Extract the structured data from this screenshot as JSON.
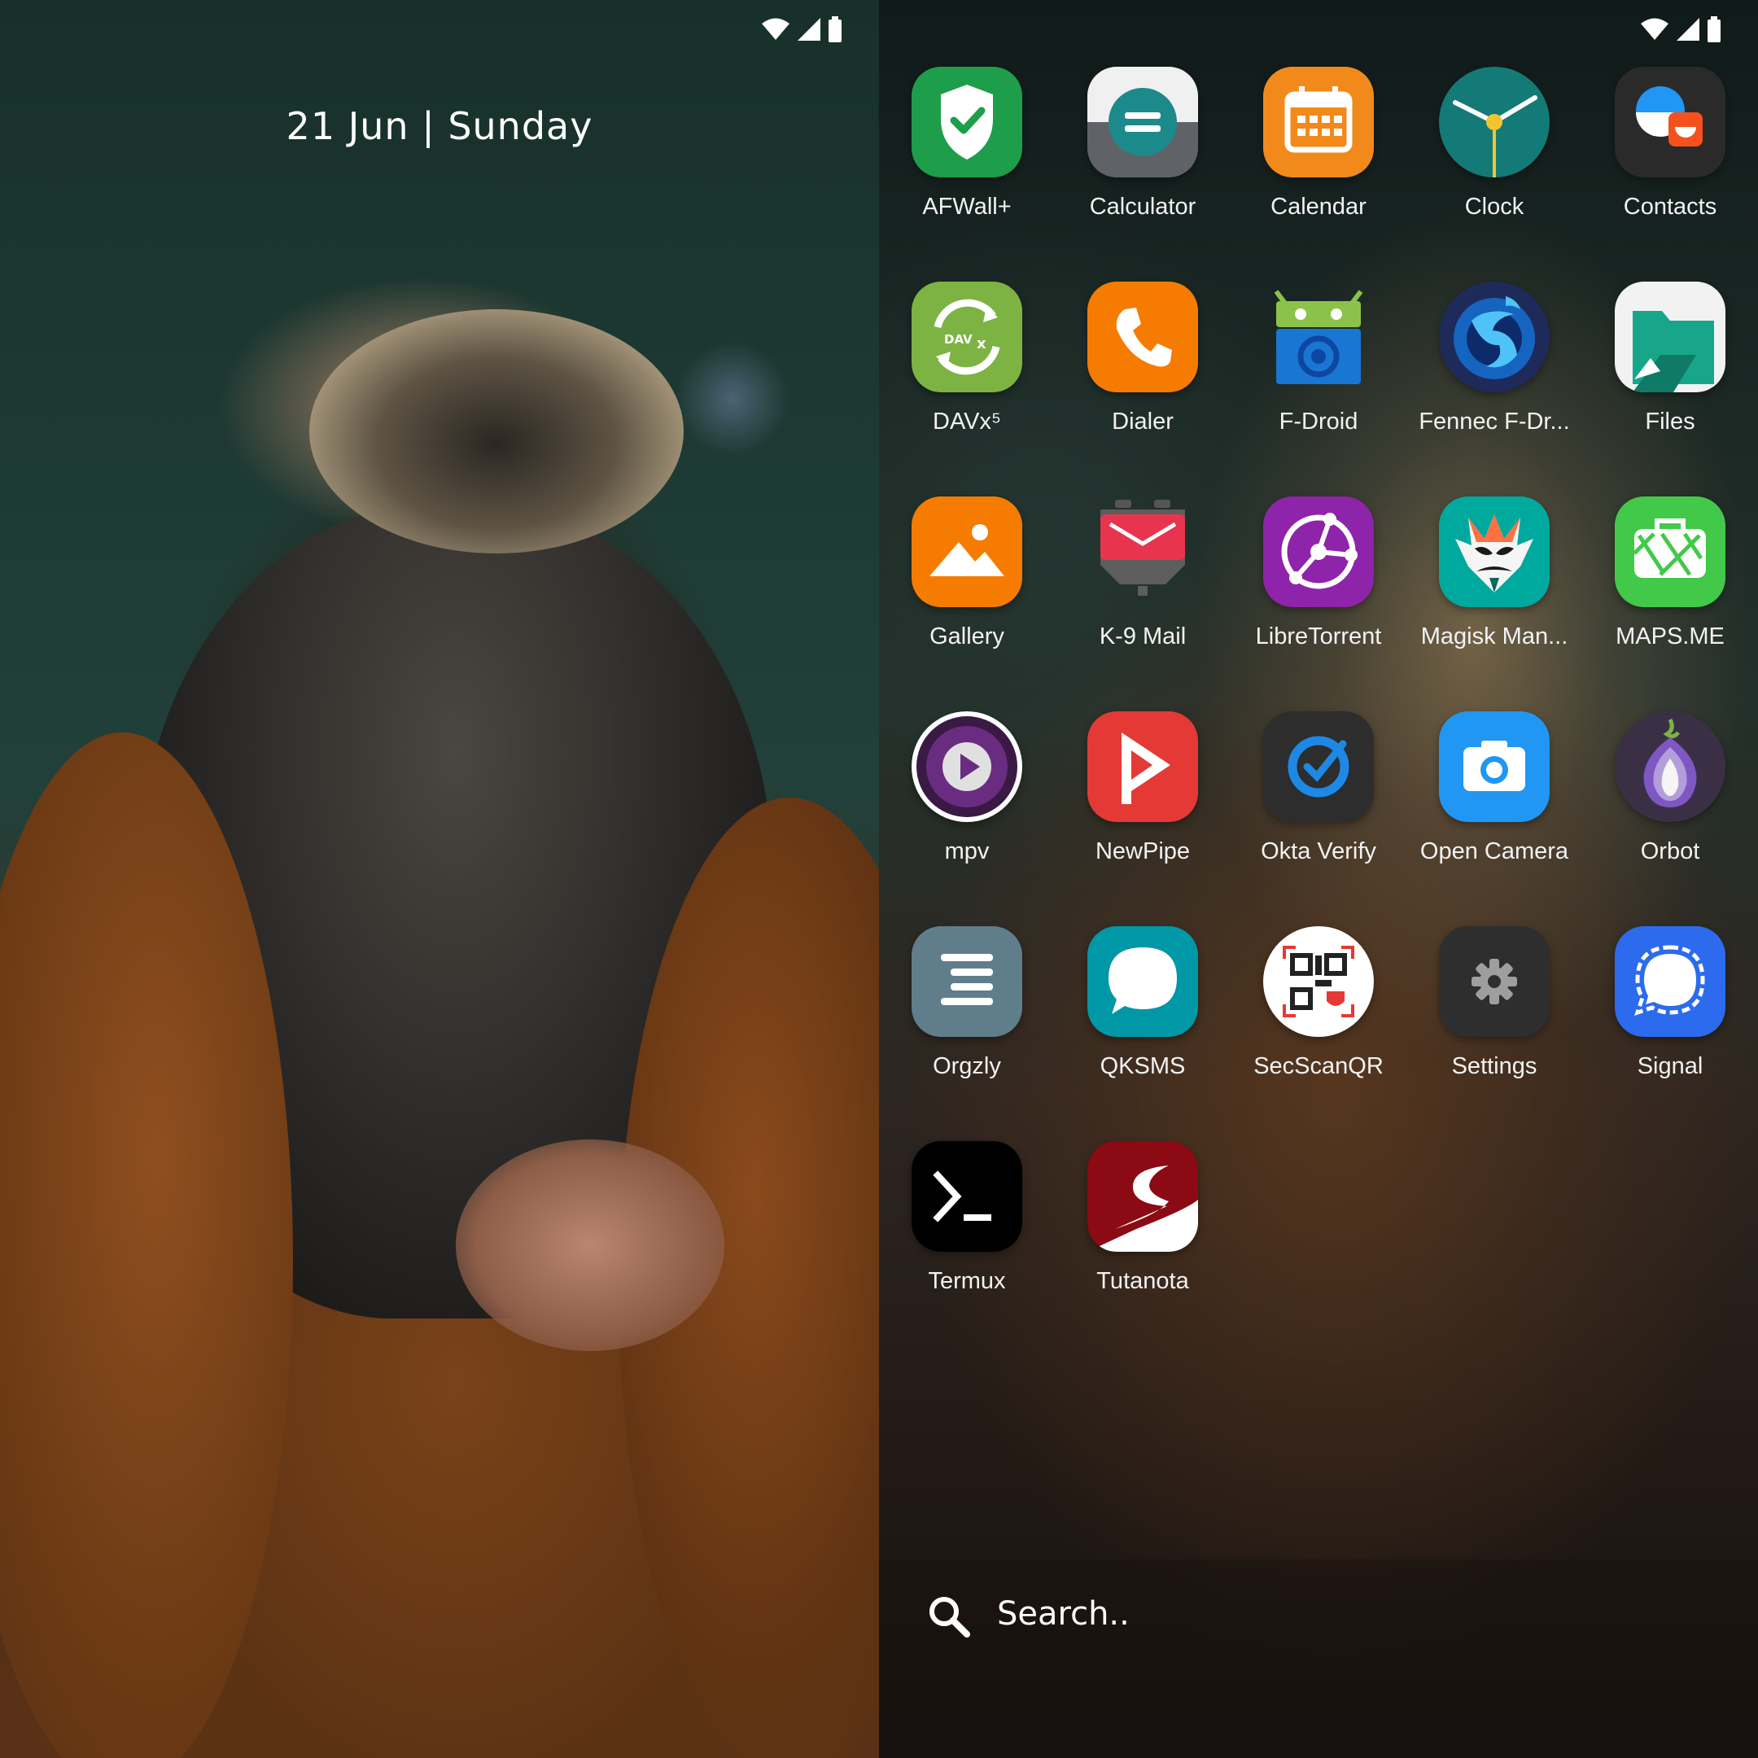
{
  "lock_screen": {
    "date": "21 Jun | Sunday"
  },
  "status_bar": {
    "icons": [
      "wifi-icon",
      "signal-icon",
      "battery-icon"
    ]
  },
  "apps": [
    {
      "label": "AFWall+",
      "icon": "afwall-shield-icon",
      "color": "#1e9d4b"
    },
    {
      "label": "Calculator",
      "icon": "calculator-icon",
      "color": "#e8e8e8"
    },
    {
      "label": "Calendar",
      "icon": "calendar-icon",
      "color": "#f28a1b"
    },
    {
      "label": "Clock",
      "icon": "clock-icon",
      "color": "#137a77"
    },
    {
      "label": "Contacts",
      "icon": "contacts-icon",
      "color": "#2a2a2a"
    },
    {
      "label": "DAVx⁵",
      "icon": "davx5-sync-icon",
      "color": "#7cb342"
    },
    {
      "label": "Dialer",
      "icon": "phone-icon",
      "color": "#f57c00"
    },
    {
      "label": "F-Droid",
      "icon": "fdroid-icon",
      "color": "#1976d2"
    },
    {
      "label": "Fennec F-Dr...",
      "icon": "fennec-fox-icon",
      "color": "#1e2a5a"
    },
    {
      "label": "Files",
      "icon": "folder-icon",
      "color": "#18a68b"
    },
    {
      "label": "Gallery",
      "icon": "gallery-icon",
      "color": "#f57c00"
    },
    {
      "label": "K-9 Mail",
      "icon": "k9-mail-icon",
      "color": "#e8344e"
    },
    {
      "label": "LibreTorrent",
      "icon": "libretorrent-icon",
      "color": "#8e24aa"
    },
    {
      "label": "Magisk Man...",
      "icon": "magisk-mask-icon",
      "color": "#00a99d"
    },
    {
      "label": "MAPS.ME",
      "icon": "maps-me-icon",
      "color": "#43c94a"
    },
    {
      "label": "mpv",
      "icon": "mpv-play-icon",
      "color": "#4a1b5a"
    },
    {
      "label": "NewPipe",
      "icon": "newpipe-play-icon",
      "color": "#e53935"
    },
    {
      "label": "Okta Verify",
      "icon": "okta-verify-icon",
      "color": "#2d2d2d"
    },
    {
      "label": "Open Camera",
      "icon": "camera-icon",
      "color": "#2196f3"
    },
    {
      "label": "Orbot",
      "icon": "orbot-onion-icon",
      "color": "#3b2f45"
    },
    {
      "label": "Orgzly",
      "icon": "orgzly-icon",
      "color": "#607d8b"
    },
    {
      "label": "QKSMS",
      "icon": "qksms-bubble-icon",
      "color": "#0097a7"
    },
    {
      "label": "SecScanQR",
      "icon": "qr-code-icon",
      "color": "#ffffff"
    },
    {
      "label": "Settings",
      "icon": "gear-icon",
      "color": "#2e2e2e"
    },
    {
      "label": "Signal",
      "icon": "signal-bubble-icon",
      "color": "#2c6bed"
    },
    {
      "label": "Termux",
      "icon": "terminal-icon",
      "color": "#000000"
    },
    {
      "label": "Tutanota",
      "icon": "tutanota-icon",
      "color": "#8b0a14"
    }
  ],
  "search": {
    "placeholder": "Search.."
  }
}
